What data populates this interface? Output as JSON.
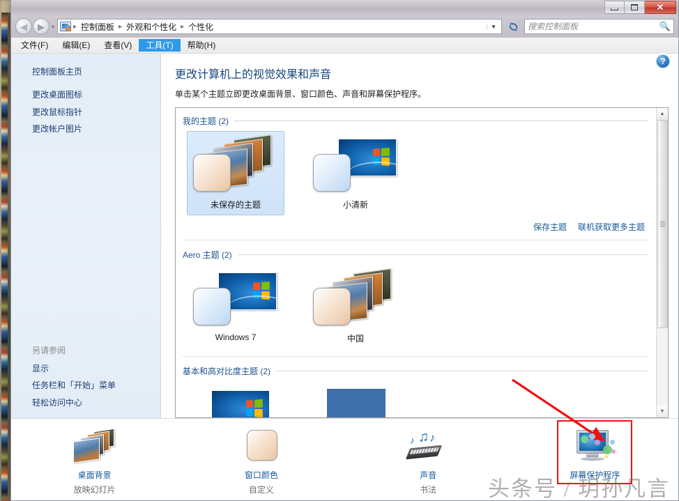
{
  "window": {
    "minimize_label": "最小化",
    "maximize_label": "最大化",
    "close_label": "✕"
  },
  "address_bar": {
    "icon": "control-panel-icon",
    "crumbs": [
      "控制面板",
      "外观和个性化",
      "个性化"
    ],
    "separator": "▸",
    "dropdown_icon": "▼",
    "refresh_icon": "⟳"
  },
  "search": {
    "placeholder": "搜索控制面板",
    "value": "",
    "icon": "search-icon"
  },
  "menubar": {
    "items": [
      {
        "label": "文件(F)",
        "active": false
      },
      {
        "label": "编辑(E)",
        "active": false
      },
      {
        "label": "查看(V)",
        "active": false
      },
      {
        "label": "工具(T)",
        "active": true
      },
      {
        "label": "帮助(H)",
        "active": false
      }
    ]
  },
  "sidebar": {
    "home_label": "控制面板主页",
    "links": [
      "更改桌面图标",
      "更改鼠标指针",
      "更改帐户图片"
    ],
    "see_also_head": "另请参阅",
    "see_also": [
      "显示",
      "任务栏和「开始」菜单",
      "轻松访问中心"
    ]
  },
  "content": {
    "title": "更改计算机上的视觉效果和声音",
    "subtitle": "单击某个主题立即更改桌面背景、窗口颜色、声音和屏幕保护程序。",
    "help_label": "?",
    "groups": [
      {
        "title": "我的主题 (2)",
        "themes": [
          {
            "name": "未保存的主题",
            "selected": true,
            "art": "stack-peach"
          },
          {
            "name": "小清新",
            "selected": false,
            "art": "win7-blue"
          }
        ],
        "links": [
          "保存主题",
          "联机获取更多主题"
        ]
      },
      {
        "title": "Aero 主题 (2)",
        "themes": [
          {
            "name": "Windows 7",
            "selected": false,
            "art": "win7-blue"
          },
          {
            "name": "中国",
            "selected": false,
            "art": "stack-peach"
          }
        ],
        "links": []
      },
      {
        "title": "基本和高对比度主题 (2)",
        "themes": [
          {
            "name": "",
            "selected": false,
            "art": "basic"
          },
          {
            "name": "",
            "selected": false,
            "art": "highcontrast"
          }
        ],
        "links": []
      }
    ]
  },
  "bottom_bar": {
    "items": [
      {
        "label": "桌面背景",
        "sub": "放映幻灯片",
        "icon": "desktop-background-icon",
        "highlighted": false
      },
      {
        "label": "窗口颜色",
        "sub": "自定义",
        "icon": "window-color-icon",
        "highlighted": false
      },
      {
        "label": "声音",
        "sub": "书法",
        "icon": "sound-icon",
        "highlighted": false
      },
      {
        "label": "屏幕保护程序",
        "sub": "",
        "icon": "screensaver-icon",
        "highlighted": true
      }
    ]
  },
  "annotations": {
    "arrow_color": "#f01010",
    "highlight_color": "#f01010"
  },
  "watermark": {
    "text": "头条号 / 玥孙凡言"
  }
}
